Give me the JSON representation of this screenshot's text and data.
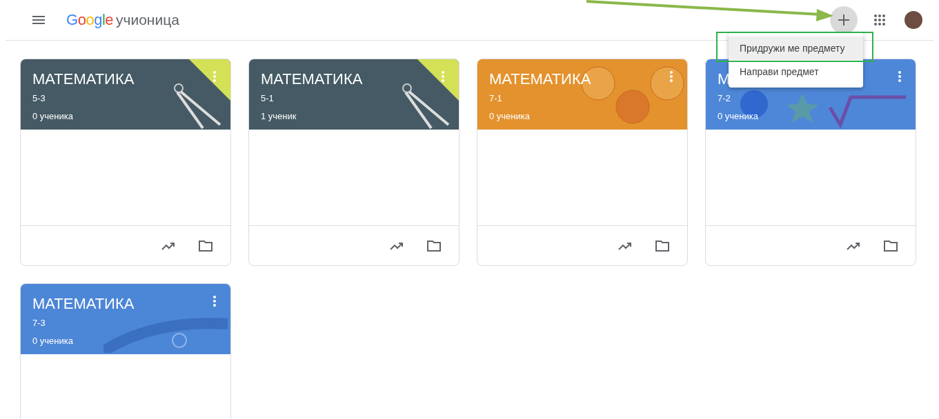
{
  "header": {
    "logo": "Google",
    "product": "учионица"
  },
  "add_menu": {
    "items": [
      {
        "label": "Придружи ме предмету",
        "selected": true
      },
      {
        "label": "Направи предмет",
        "selected": false
      }
    ]
  },
  "classes": [
    {
      "title": "МАТЕМАТИКА",
      "section": "5-3",
      "students": "0 ученика",
      "kind": "dark"
    },
    {
      "title": "МАТЕМАТИКА",
      "section": "5-1",
      "students": "1 ученик",
      "kind": "dark"
    },
    {
      "title": "МАТЕМАТИКА",
      "section": "7-1",
      "students": "0 ученика",
      "kind": "orange"
    },
    {
      "title": "М",
      "section": "7-2",
      "students": "0 ученика",
      "kind": "blue"
    },
    {
      "title": "МАТЕМАТИКА",
      "section": "7-3",
      "students": "0 ученика",
      "kind": "doodle"
    }
  ]
}
